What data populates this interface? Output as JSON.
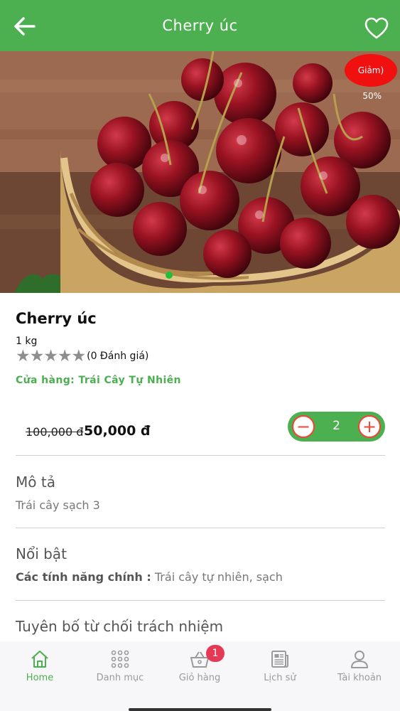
{
  "header": {
    "title": "Cherry úc"
  },
  "hero": {
    "discount_label": "Giảm)",
    "discount_percent": "50%",
    "slide_index": 1,
    "slide_count": 1
  },
  "product": {
    "name": "Cherry úc",
    "unit": "1 kg",
    "rating_value": 5,
    "rating_max": 5,
    "rating_text": "(0 Đánh giá)",
    "store": "Cửa hàng: Trái Cây Tự Nhiên",
    "old_price": "100,000 đ",
    "price": "50,000 đ",
    "quantity": "2",
    "stepper_minus": "−",
    "stepper_plus": "+"
  },
  "sections": {
    "description": {
      "title": "Mô tả",
      "body": "Trái cây sạch 3"
    },
    "highlights": {
      "title": "Nổi bật",
      "body_label": "Các tính năng chính :",
      "body_value": " Trái cây tự nhiên, sạch"
    },
    "disclaimer": {
      "title": "Tuyên bố từ chối trách nhiệm"
    }
  },
  "bottom_nav": {
    "items": [
      {
        "label": "Home",
        "icon": "home-icon",
        "active": true
      },
      {
        "label": "Danh mục",
        "icon": "grid-icon",
        "active": false
      },
      {
        "label": "Giỏ hàng",
        "icon": "basket-icon",
        "active": false
      },
      {
        "label": "Lịch sử",
        "icon": "newspaper-icon",
        "active": false
      },
      {
        "label": "Tài khoản",
        "icon": "user-icon",
        "active": false
      }
    ],
    "cart_count": "1"
  },
  "colors": {
    "primary": "#4caf50",
    "discount": "#f01010",
    "badge": "#e53955",
    "stepper_icon": "#f44336"
  }
}
